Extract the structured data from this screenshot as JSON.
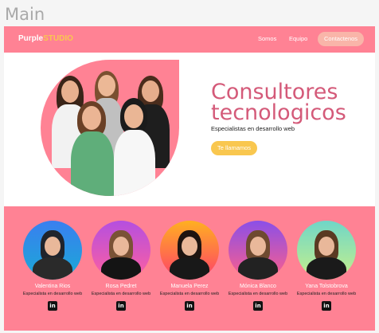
{
  "frame_label": "Main",
  "header": {
    "logo_main": "Purple",
    "logo_accent": "STUDIO",
    "nav": [
      "Somos",
      "Equipo"
    ],
    "contact_button": "Contactenos"
  },
  "hero": {
    "title": "Consultores tecnologicos",
    "subtitle": "Especialistas en desarrollo web",
    "cta": "Te llamamos"
  },
  "team": {
    "members": [
      {
        "name": "Valentina Rios",
        "role": "Especialista en desarrollo web",
        "icon": "linkedin-icon"
      },
      {
        "name": "Rosa Pedret",
        "role": "Especialista en desarrollo web",
        "icon": "linkedin-icon"
      },
      {
        "name": "Manuela Perez",
        "role": "Especialista en desarrollo web",
        "icon": "linkedin-icon"
      },
      {
        "name": "Mónica Blanco",
        "role": "Especialista en desarrollo web",
        "icon": "linkedin-icon"
      },
      {
        "name": "Yana Tolstobrova",
        "role": "Especialista en desarrollo web",
        "icon": "linkedin-icon"
      }
    ]
  },
  "colors": {
    "brand_pink": "#ff8294",
    "accent_yellow": "#f9c74f",
    "title_pink": "#d45a79"
  }
}
